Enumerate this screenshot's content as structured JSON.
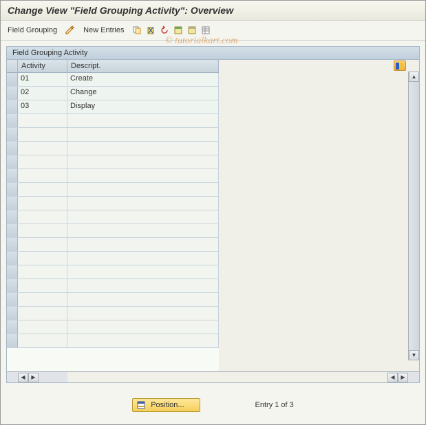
{
  "title": "Change View \"Field Grouping Activity\": Overview",
  "toolbar": {
    "field_grouping": "Field Grouping",
    "new_entries": "New Entries"
  },
  "group": {
    "title": "Field Grouping Activity"
  },
  "columns": {
    "activity": "Activity",
    "descript": "Descript."
  },
  "rows": [
    {
      "activity": "01",
      "descript": "Create"
    },
    {
      "activity": "02",
      "descript": "Change"
    },
    {
      "activity": "03",
      "descript": "Display"
    }
  ],
  "footer": {
    "position": "Position...",
    "entry_status": "Entry 1 of 3"
  },
  "watermark": "© tutorialkart.com"
}
